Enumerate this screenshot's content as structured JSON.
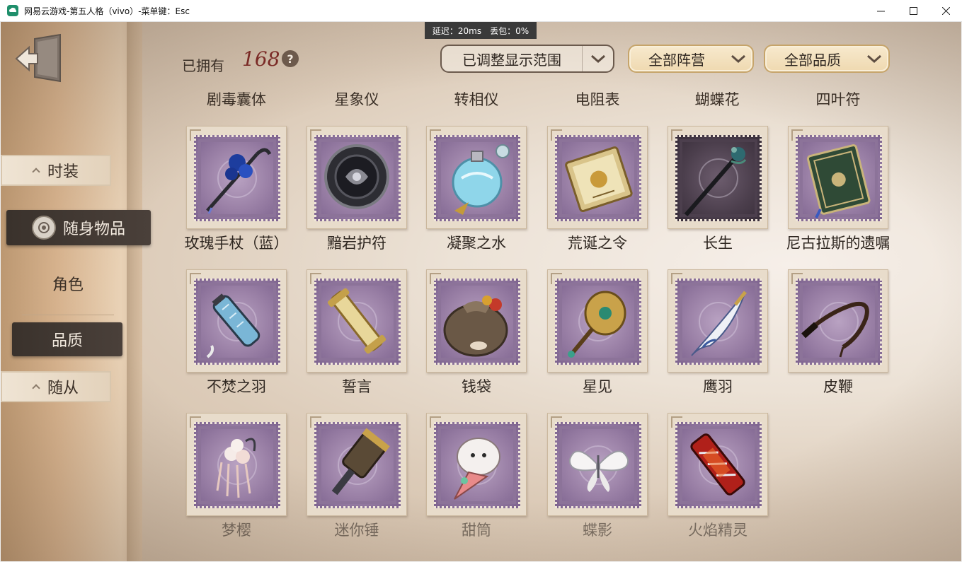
{
  "window": {
    "title": "网易云游戏-第五人格（vivo）-菜单键：Esc",
    "minimize": "—",
    "maximize": "☐",
    "close": "✕"
  },
  "network": {
    "latency": "延迟：20ms",
    "packet_loss": "丢包：0%"
  },
  "sidebar": {
    "tabs": [
      {
        "label": "时装"
      },
      {
        "label": "随身物品"
      },
      {
        "label": "角色"
      },
      {
        "label": "品质"
      },
      {
        "label": "随从"
      }
    ]
  },
  "header": {
    "owned_label": "已拥有",
    "owned_count": "168",
    "help": "?",
    "filters": {
      "range": "已调整显示范围",
      "camp": "全部阵营",
      "quality": "全部品质"
    }
  },
  "top_row_labels": [
    "剧毒囊体",
    "星象仪",
    "转相仪",
    "电阻表",
    "蝴蝶花",
    "四叶符"
  ],
  "items": [
    {
      "name": "玫瑰手杖（蓝）",
      "icon": "rose-cane-icon"
    },
    {
      "name": "黯岩护符",
      "icon": "dark-rock-amulet-icon"
    },
    {
      "name": "凝聚之水",
      "icon": "condensed-water-icon"
    },
    {
      "name": "荒诞之令",
      "icon": "absurd-decree-icon"
    },
    {
      "name": "长生",
      "icon": "longevity-staff-icon"
    },
    {
      "name": "尼古拉斯的遗嘱",
      "icon": "nicholas-will-icon"
    },
    {
      "name": "不焚之羽",
      "icon": "unburning-feather-icon"
    },
    {
      "name": "誓言",
      "icon": "oath-scroll-icon"
    },
    {
      "name": "钱袋",
      "icon": "money-bag-icon"
    },
    {
      "name": "星见",
      "icon": "star-mirror-icon"
    },
    {
      "name": "鹰羽",
      "icon": "eagle-feather-icon"
    },
    {
      "name": "皮鞭",
      "icon": "whip-icon"
    },
    {
      "name": "梦樱",
      "icon": "dream-sakura-icon"
    },
    {
      "name": "迷你锤",
      "icon": "mini-hammer-icon"
    },
    {
      "name": "甜筒",
      "icon": "ice-cream-cone-icon"
    },
    {
      "name": "蝶影",
      "icon": "butterfly-shadow-icon"
    },
    {
      "name": "火焰精灵",
      "icon": "flame-spirit-icon"
    }
  ],
  "colors": {
    "stamp_purple": "#9a80a6",
    "count_red": "#7a2a26",
    "dark_tab": "#3a322c",
    "gold_border": "#c6a46a"
  }
}
